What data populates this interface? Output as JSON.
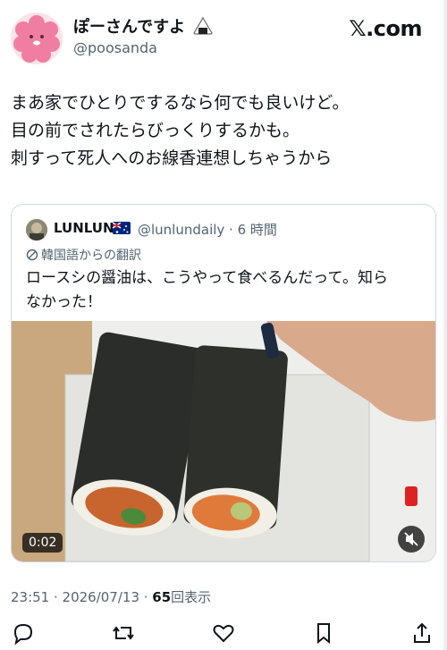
{
  "author": {
    "name": "ぽーさんですよ",
    "handle": "@poosanda"
  },
  "site_logo": "𝕏.com",
  "tweet": {
    "lines": [
      "まあ家でひとりでするなら何でも良いけど。",
      "目の前でされたらびっくりするかも。",
      "刺すって死人へのお線香連想しちゃうから"
    ]
  },
  "quote": {
    "name": "LUNLUN",
    "handle_time": "@lunlundaily · 6 時間",
    "translation_note": "韓国語からの翻訳",
    "text_lines": [
      "ロースシの醤油は、こうやって食べるんだって。知ら",
      "なかった！"
    ],
    "video_duration": "0:02"
  },
  "meta": {
    "time_date": "23:51 · 2026/07/13 · ",
    "views_count": "65",
    "views_label": "回表示"
  },
  "icons": [
    "reply-icon",
    "retweet-icon",
    "like-icon",
    "bookmark-icon",
    "share-icon",
    "mute-icon",
    "translate-icon",
    "onigiri-icon",
    "flag-au-icon"
  ],
  "colors": {
    "text": "#0f1419",
    "secondary": "#536471",
    "border": "#cfd9de"
  }
}
